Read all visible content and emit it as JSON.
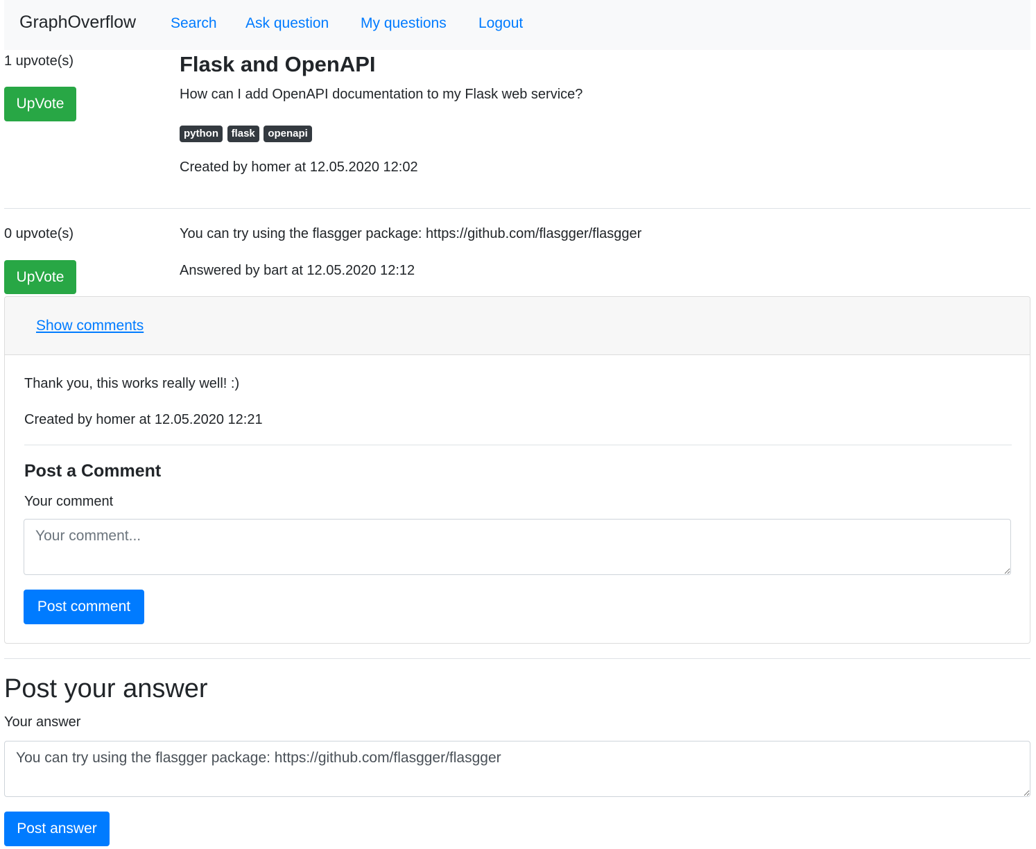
{
  "navbar": {
    "brand": "GraphOverflow",
    "links": [
      "Search",
      "Ask question",
      "My questions",
      "Logout"
    ]
  },
  "question": {
    "upvotes": "1 upvote(s)",
    "upvote_label": "UpVote",
    "title": "Flask and OpenAPI",
    "body": "How can I add OpenAPI documentation to my Flask web service?",
    "tags": [
      "python",
      "flask",
      "openapi"
    ],
    "meta": "Created by homer at 12.05.2020 12:02"
  },
  "answer": {
    "upvotes": "0 upvote(s)",
    "upvote_label": "UpVote",
    "body": "You can try using the flasgger package: https://github.com/flasgger/flasgger",
    "meta": "Answered by bart at 12.05.2020 12:12"
  },
  "comments": {
    "toggle_label": "Show comments",
    "items": [
      {
        "text": "Thank you, this works really well! :)",
        "meta": "Created by homer at 12.05.2020 12:21"
      }
    ],
    "form": {
      "heading": "Post a Comment",
      "label": "Your comment",
      "placeholder": "Your comment...",
      "value": "",
      "submit_label": "Post comment"
    }
  },
  "answer_form": {
    "heading": "Post your answer",
    "label": "Your answer",
    "value": "You can try using the flasgger package: https://github.com/flasgger/flasgger",
    "submit_label": "Post answer"
  },
  "colors": {
    "primary": "#007bff",
    "success": "#28a745",
    "badge": "#343a40",
    "navbar_bg": "#f8f9fa"
  }
}
